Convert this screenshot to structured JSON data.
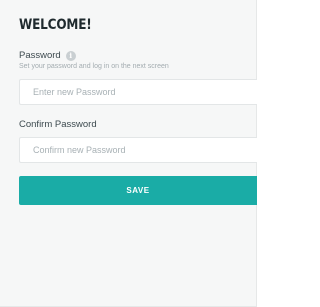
{
  "page": {
    "title": "WELCOME!"
  },
  "password": {
    "label": "Password",
    "info_icon": "info-icon",
    "hint": "Set your password and log in on the next screen",
    "placeholder": "Enter new Password",
    "value": ""
  },
  "confirm_password": {
    "label": "Confirm Password",
    "placeholder": "Confirm new Password",
    "value": ""
  },
  "save": {
    "label": "SAVE"
  },
  "colors": {
    "accent": "#1aaca6",
    "background": "#f6f7f7",
    "title": "#1f2a2e"
  }
}
